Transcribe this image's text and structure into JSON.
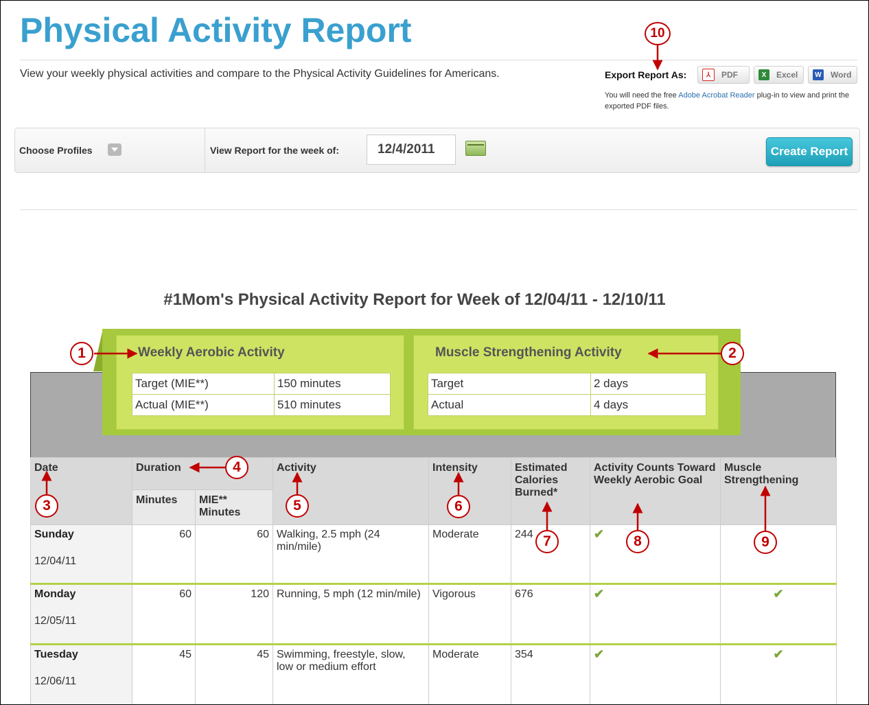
{
  "page": {
    "title": "Physical Activity Report",
    "intro": "View your weekly physical activities and compare to the Physical Activity Guidelines for Americans."
  },
  "export": {
    "label": "Export Report As:",
    "buttons": [
      {
        "icon": "pdf-icon",
        "label": "PDF"
      },
      {
        "icon": "excel-icon",
        "label": "Excel"
      },
      {
        "icon": "word-icon",
        "label": "Word"
      }
    ],
    "note_before": "You will need the free ",
    "note_link": "Adobe Acrobat Reader",
    "note_after": " plug-in to view and print the exported PDF files."
  },
  "toolbar": {
    "choose_profiles": "Choose Profiles",
    "week_label": "View Report for the week of:",
    "week_value": "12/4/2011",
    "create_label": "Create Report"
  },
  "report": {
    "title": "#1Mom's Physical Activity Report for Week of 12/04/11 - 12/10/11",
    "aerobic": {
      "title": "Weekly Aerobic Activity",
      "rows": [
        {
          "label": "Target (MIE**)",
          "value": "150 minutes"
        },
        {
          "label": "Actual (MIE**)",
          "value": "510 minutes"
        }
      ]
    },
    "muscle": {
      "title": "Muscle Strengthening Activity",
      "rows": [
        {
          "label": "Target",
          "value": "2 days"
        },
        {
          "label": "Actual",
          "value": "4 days"
        }
      ]
    },
    "columns": {
      "date": "Date",
      "duration": "Duration",
      "minutes": "Minutes",
      "mie_minutes": "MIE** Minutes",
      "activity": "Activity",
      "intensity": "Intensity",
      "calories": "Estimated Calories Burned*",
      "counts": "Activity Counts Toward Weekly Aerobic Goal",
      "muscle": "Muscle Strengthening"
    },
    "rows": [
      {
        "day": "Sunday",
        "date": "12/04/11",
        "minutes": "60",
        "mie": "60",
        "activity": "Walking, 2.5 mph (24 min/mile)",
        "intensity": "Moderate",
        "calories": "244",
        "counts": true,
        "muscle": false
      },
      {
        "day": "Monday",
        "date": "12/05/11",
        "minutes": "60",
        "mie": "120",
        "activity": "Running, 5 mph (12 min/mile)",
        "intensity": "Vigorous",
        "calories": "676",
        "counts": true,
        "muscle": true
      },
      {
        "day": "Tuesday",
        "date": "12/06/11",
        "minutes": "45",
        "mie": "45",
        "activity": "Swimming, freestyle, slow, low or medium effort",
        "intensity": "Moderate",
        "calories": "354",
        "counts": true,
        "muscle": true
      }
    ],
    "check_glyph": "✔"
  },
  "callouts": [
    "1",
    "2",
    "3",
    "4",
    "5",
    "6",
    "7",
    "8",
    "9",
    "10"
  ],
  "colors": {
    "title_blue": "#3aa0cf",
    "accent_green": "#a6c93e",
    "callout_red": "#c00000",
    "button_teal": "#1ea0b8"
  }
}
